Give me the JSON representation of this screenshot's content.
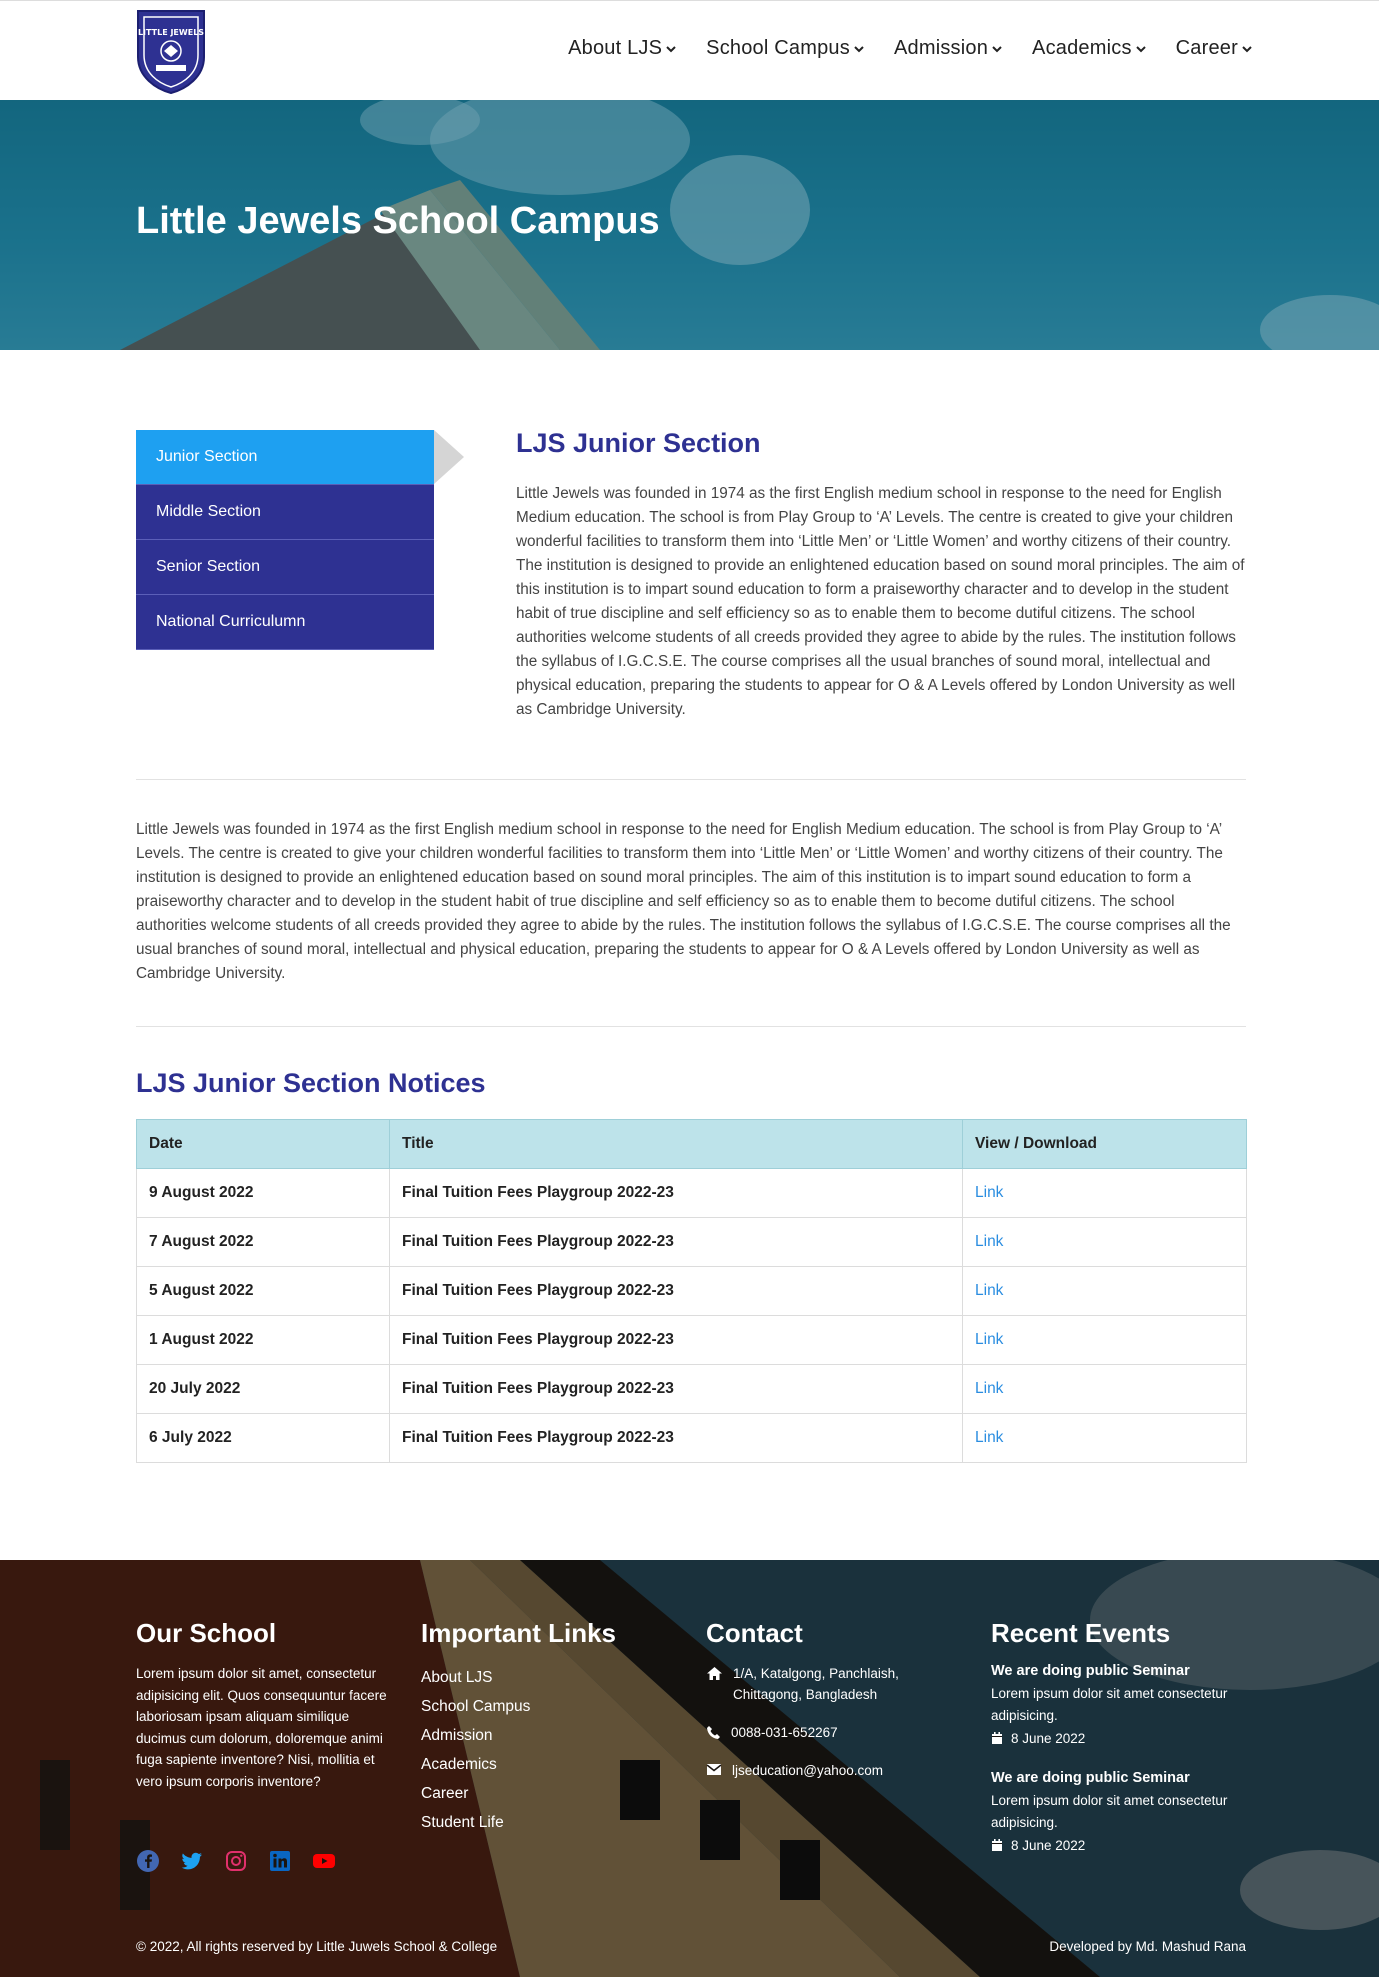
{
  "logo": {
    "text": "LITTLE JEWELS"
  },
  "nav": {
    "items": [
      {
        "label": "About LJS"
      },
      {
        "label": "School Campus"
      },
      {
        "label": "Admission"
      },
      {
        "label": "Academics"
      },
      {
        "label": "Career"
      }
    ]
  },
  "hero": {
    "title": "Little Jewels School Campus"
  },
  "sidebar": {
    "tabs": [
      {
        "label": "Junior Section",
        "active": true
      },
      {
        "label": "Middle Section",
        "active": false
      },
      {
        "label": "Senior Section",
        "active": false
      },
      {
        "label": "National Curriculumn",
        "active": false
      }
    ]
  },
  "section": {
    "title": "LJS Junior Section",
    "text": "Little Jewels was founded in 1974 as the first English medium school in response to the need for English Medium education. The school is from Play Group to ‘A’ Levels. The centre is created to give your children wonderful facilities to transform them into ‘Little Men’ or ‘Little Women’ and worthy citizens of their country. The institution is designed to provide an enlightened education based on sound moral principles. The aim of this institution is to impart sound education to form a praiseworthy character and to develop in the student habit of true discipline and self efficiency so as to enable them to become dutiful citizens. The school authorities welcome students of all creeds provided they agree to abide by the rules. The institution follows the syllabus of I.G.C.S.E. The course comprises all the usual branches of sound moral, intellectual and physical education, preparing the students to appear for O & A Levels offered by London University as well as Cambridge University.",
    "full_text": "Little Jewels was founded in 1974 as the first English medium school in response to the need for English Medium education. The school is from Play Group to ‘A’ Levels. The centre is created to give your children wonderful facilities to transform them into ‘Little Men’ or ‘Little Women’ and worthy citizens of their country. The institution is designed to provide an enlightened education based on sound moral principles. The aim of this institution is to impart sound education to form a praiseworthy character and to develop in the student habit of true discipline and self efficiency so as to enable them to become dutiful citizens. The school authorities welcome students of all creeds provided they agree to abide by the rules. The institution follows the syllabus of I.G.C.S.E. The course comprises all the usual branches of sound moral, intellectual and physical education, preparing the students to appear for O & A Levels offered by London University as well as Cambridge University."
  },
  "notices": {
    "title": "LJS Junior Section Notices",
    "headers": {
      "date": "Date",
      "title": "Title",
      "view": "View / Download"
    },
    "rows": [
      {
        "date": "9 August 2022",
        "title": "Final Tuition Fees Playgroup 2022-23",
        "link": "Link"
      },
      {
        "date": "7 August 2022",
        "title": "Final Tuition Fees Playgroup 2022-23",
        "link": "Link"
      },
      {
        "date": "5 August 2022",
        "title": "Final Tuition Fees Playgroup 2022-23",
        "link": "Link"
      },
      {
        "date": "1 August 2022",
        "title": "Final Tuition Fees Playgroup 2022-23",
        "link": "Link"
      },
      {
        "date": "20 July 2022",
        "title": "Final Tuition Fees Playgroup 2022-23",
        "link": "Link"
      },
      {
        "date": "6 July 2022",
        "title": "Final Tuition Fees Playgroup 2022-23",
        "link": "Link"
      }
    ]
  },
  "footer": {
    "our_school": {
      "title": "Our School",
      "text": "Lorem ipsum dolor sit amet, consectetur adipisicing elit. Quos consequuntur facere laboriosam ipsam aliquam similique ducimus cum dolorum, doloremque animi fuga sapiente inventore? Nisi, mollitia et vero ipsum corporis inventore?"
    },
    "links": {
      "title": "Important Links",
      "items": [
        "About LJS",
        "School Campus",
        "Admission",
        "Academics",
        "Career",
        "Student Life"
      ]
    },
    "contact": {
      "title": "Contact",
      "address_line1": "1/A, Katalgong, Panchlaish,",
      "address_line2": "Chittagong, Bangladesh",
      "phone": "0088-031-652267",
      "email": "ljseducation@yahoo.com"
    },
    "events": {
      "title": "Recent Events",
      "items": [
        {
          "title": "We are doing public Seminar",
          "text": "Lorem ipsum dolor sit amet consectetur adipisicing.",
          "date": "8 June 2022"
        },
        {
          "title": "We are doing public Seminar",
          "text": "Lorem ipsum dolor sit amet consectetur adipisicing.",
          "date": "8 June 2022"
        }
      ]
    },
    "socials": [
      "facebook-icon",
      "twitter-icon",
      "instagram-icon",
      "linkedin-icon",
      "youtube-icon"
    ],
    "copyright": "© 2022, All rights reserved by Little Juwels School & College",
    "developer": "Developed by Md. Mashud Rana"
  },
  "colors": {
    "brand": "#2e3192",
    "active_tab": "#1ea0f1",
    "link": "#2a8de0",
    "table_header": "#bde3ea"
  }
}
